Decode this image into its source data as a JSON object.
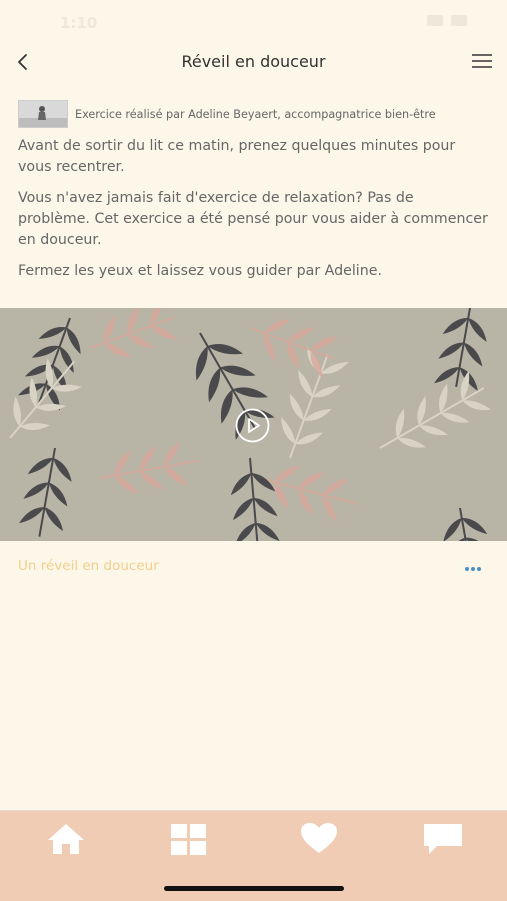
{
  "status_bar": {
    "time": "1:10"
  },
  "header": {
    "title": "Réveil en douceur"
  },
  "author": {
    "text": "Exercice réalisé par Adeline Beyaert, accompagnatrice bien-être"
  },
  "description": [
    "Avant de sortir du lit ce matin, prenez quelques minutes pour vous recentrer.",
    "Vous n'avez jamais fait d'exercice de relaxation? Pas de problème. Cet exercice a été pensé pour vous aider à commencer en douceur.",
    "Fermez les yeux et laissez vous guider par Adeline."
  ],
  "track": {
    "title": "Un réveil en douceur"
  },
  "colors": {
    "background": "#fdf7ea",
    "tabbar": "#f1ccb5",
    "track_title": "#f2cf8c",
    "more_dots": "#4a8fc9",
    "video_bg": "#b8b4a6"
  },
  "tabs": [
    {
      "icon": "home-icon"
    },
    {
      "icon": "grid-icon"
    },
    {
      "icon": "heart-icon"
    },
    {
      "icon": "chat-icon"
    }
  ]
}
